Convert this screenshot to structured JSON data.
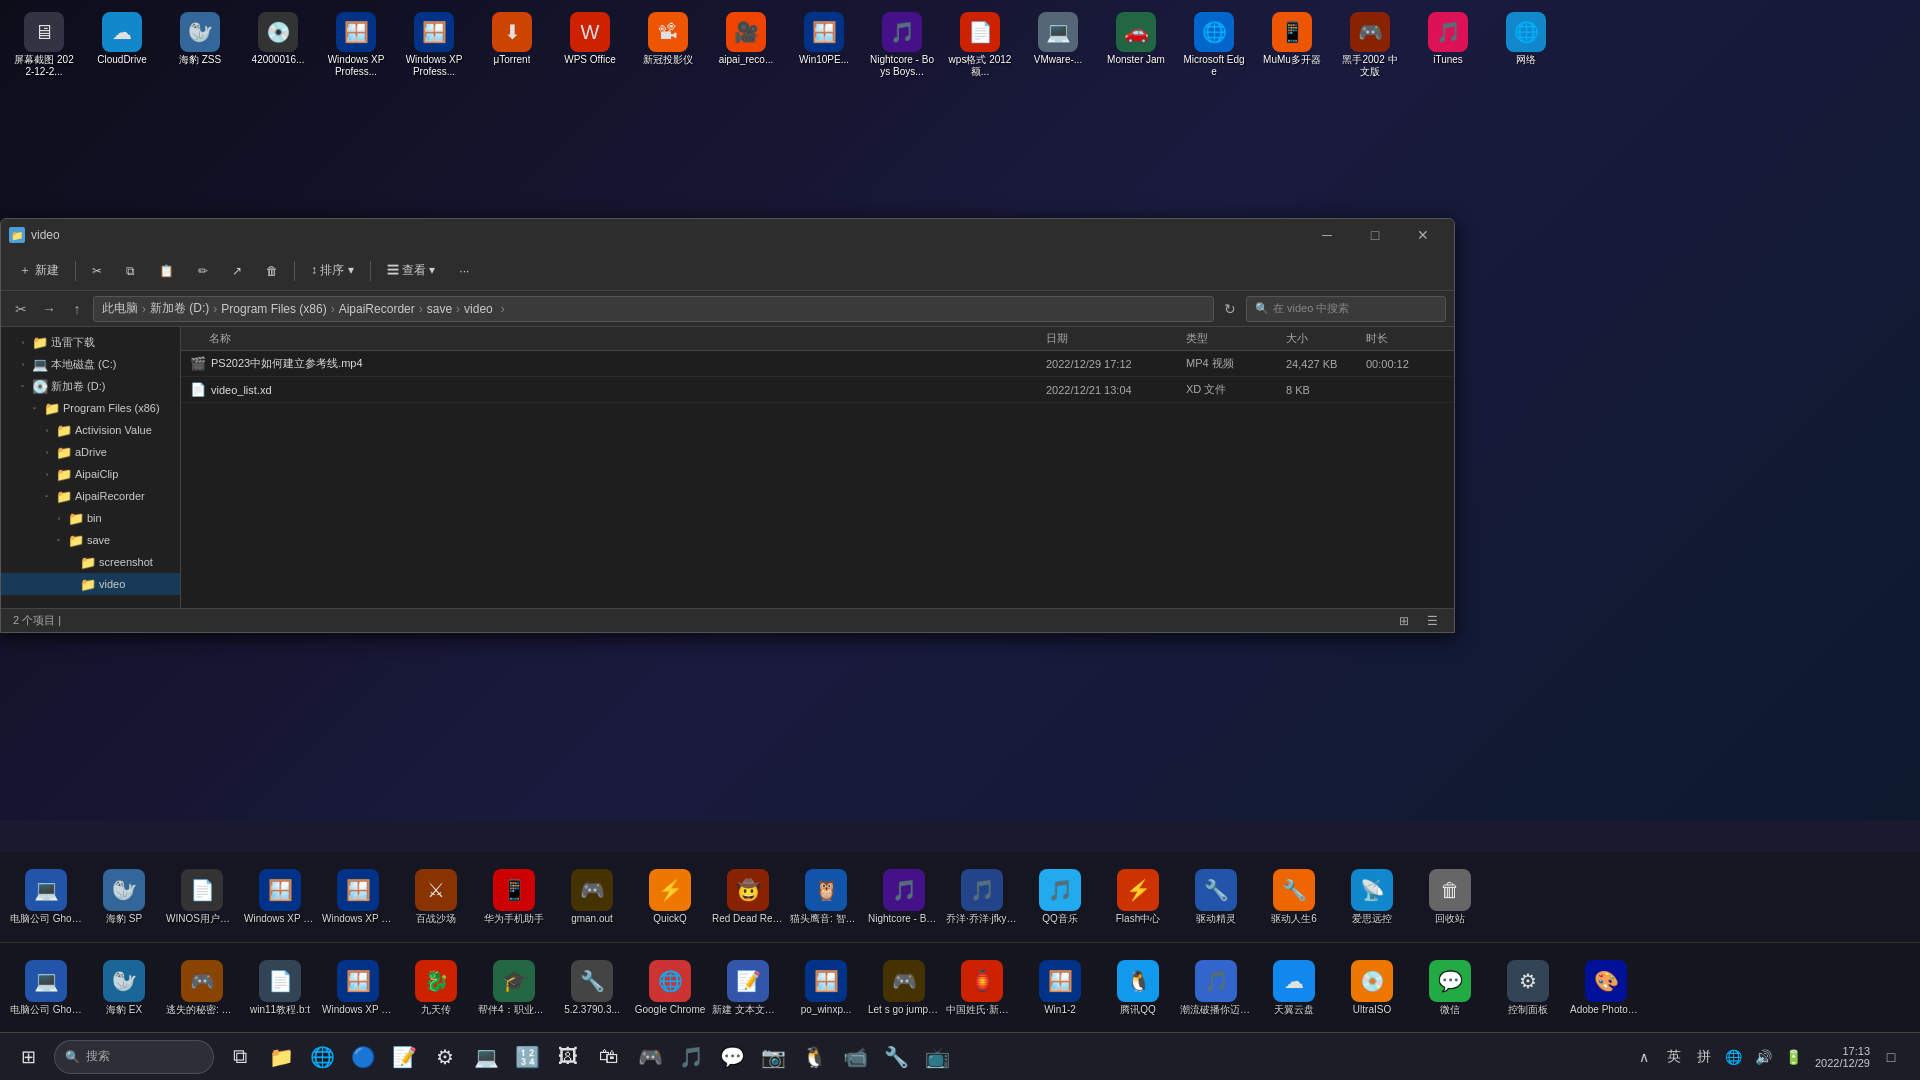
{
  "window": {
    "title": "video",
    "icon": "📁"
  },
  "titlebar": {
    "minimize": "─",
    "maximize": "□",
    "close": "✕"
  },
  "toolbar": {
    "new": "新建",
    "cut": "✂",
    "copy": "⧉",
    "paste": "📋",
    "rename": "✏",
    "share": "↗",
    "delete": "🗑",
    "sort": "↕ 排序 ▾",
    "view": "☰ 查看 ▾",
    "more": "···"
  },
  "addressbar": {
    "back": "←",
    "forward": "→",
    "up": "↑",
    "parent": "↑",
    "path": "此电脑 > 新加卷 (D:) > Program Files (x86) > AipaiRecorder > save > video",
    "breadcrumbs": [
      "此电脑",
      "新加卷 (D:)",
      "Program Files (x86)",
      "AipaiRecorder",
      "save",
      "video"
    ],
    "search_placeholder": "在 video 中搜索",
    "refresh": "↻",
    "chevron": ">"
  },
  "sidebar": {
    "items": [
      {
        "label": "迅雷下载",
        "level": 1,
        "icon": "📁",
        "expanded": false
      },
      {
        "label": "本地磁盘 (C:)",
        "level": 1,
        "icon": "💻",
        "expanded": false
      },
      {
        "label": "新加卷 (D:)",
        "level": 1,
        "icon": "💽",
        "expanded": false
      },
      {
        "label": "Program Files (x86)",
        "level": 2,
        "icon": "📁",
        "expanded": false
      },
      {
        "label": "Activision Value",
        "level": 3,
        "icon": "📁",
        "expanded": false
      },
      {
        "label": "aDrive",
        "level": 3,
        "icon": "📁",
        "expanded": false
      },
      {
        "label": "AipaiClip",
        "level": 3,
        "icon": "📁",
        "expanded": false
      },
      {
        "label": "AipaiRecorder",
        "level": 3,
        "icon": "📁",
        "expanded": true
      },
      {
        "label": "bin",
        "level": 4,
        "icon": "📁",
        "expanded": false
      },
      {
        "label": "save",
        "level": 4,
        "icon": "📁",
        "expanded": true
      },
      {
        "label": "screenshot",
        "level": 5,
        "icon": "📁",
        "expanded": false
      },
      {
        "label": "video",
        "level": 5,
        "icon": "📁",
        "expanded": false,
        "selected": true
      }
    ]
  },
  "columns": {
    "name": "名称",
    "date": "日期",
    "type": "类型",
    "size": "大小",
    "duration": "时长"
  },
  "files": [
    {
      "name": "PS2023中如何建立参考线.mp4",
      "icon": "🎬",
      "date": "2022/12/29 17:12",
      "type": "MP4 视频",
      "size": "24,427 KB",
      "duration": "00:00:12"
    },
    {
      "name": "video_list.xd",
      "icon": "📄",
      "date": "2022/12/21 13:04",
      "type": "XD 文件",
      "size": "8 KB",
      "duration": ""
    }
  ],
  "statusbar": {
    "count": "2 个项目",
    "cursor": "|"
  },
  "taskbar": {
    "start_icon": "⊞",
    "search_placeholder": "搜索",
    "time": "17:13",
    "date": "2022/12/29"
  },
  "bottom_tray1": [
    {
      "label": "电脑公司 Ghost XP ...",
      "icon": "💻",
      "color": "#2255aa"
    },
    {
      "label": "海豹 EX",
      "icon": "🦭",
      "color": "#1a6699"
    },
    {
      "label": "逃失的秘密: 梵洲风之谜",
      "icon": "🎮",
      "color": "#884400"
    },
    {
      "label": "win11教程.b:t",
      "icon": "📄",
      "color": "#334455"
    },
    {
      "label": "Windows XP Professional...",
      "icon": "🪟",
      "color": "#003388"
    },
    {
      "label": "九天传",
      "icon": "🐉",
      "color": "#cc2200"
    },
    {
      "label": "帮伴4：职业学校实习里...",
      "icon": "🎓",
      "color": "#226644"
    },
    {
      "label": "5.2.3790.3...",
      "icon": "🔧",
      "color": "#444"
    },
    {
      "label": "Google Chrome",
      "icon": "🌐",
      "color": "#cc3333"
    },
    {
      "label": "新建 文本文档档.b:t",
      "icon": "📝",
      "color": "#3355aa"
    },
    {
      "label": "po_winxp...",
      "icon": "🪟",
      "color": "#003388"
    },
    {
      "label": "Let s go jump arou...",
      "icon": "🎮",
      "color": "#443300"
    },
    {
      "label": "中国姓氏·新年快乐...",
      "icon": "🏮",
      "color": "#cc2200"
    },
    {
      "label": "Win1-2",
      "icon": "🪟",
      "color": "#003388"
    },
    {
      "label": "腾讯QQ",
      "icon": "🐧",
      "color": "#1199ee"
    },
    {
      "label": "潮流破播你迈: 迈尔豪 凰...",
      "icon": "🎵",
      "color": "#3366cc"
    },
    {
      "label": "天翼云盘",
      "icon": "☁",
      "color": "#1188ee"
    },
    {
      "label": "UltraISO",
      "icon": "💿",
      "color": "#ee7700"
    },
    {
      "label": "微信",
      "icon": "💬",
      "color": "#22aa44"
    },
    {
      "label": "控制面板",
      "icon": "⚙",
      "color": "#334455"
    },
    {
      "label": "Adobe Photosh...",
      "icon": "🎨",
      "color": "#001199"
    }
  ],
  "bottom_tray2": [
    {
      "label": "电脑公司 Ghost XP ...",
      "icon": "💻",
      "color": "#2255aa"
    },
    {
      "label": "海豹 SP",
      "icon": "🦭",
      "color": "#336699"
    },
    {
      "label": "WINOS用户名密码.b:t",
      "icon": "📄",
      "color": "#333"
    },
    {
      "label": "Windows XP Professional...",
      "icon": "🪟",
      "color": "#003388"
    },
    {
      "label": "Windows XP Professional...",
      "icon": "🪟",
      "color": "#003388"
    },
    {
      "label": "百战沙场",
      "icon": "⚔",
      "color": "#883300"
    },
    {
      "label": "华为手机助手",
      "icon": "📱",
      "color": "#cc0000"
    },
    {
      "label": "gman.out",
      "icon": "🎮",
      "color": "#443300"
    },
    {
      "label": "QuickQ",
      "icon": "⚡",
      "color": "#ee7700"
    },
    {
      "label": "Red Dead Redempt...",
      "icon": "🤠",
      "color": "#882200"
    },
    {
      "label": "猫头鹰音: 智能高清...",
      "icon": "🦉",
      "color": "#1155aa"
    },
    {
      "label": "Nightcore - Boys Boy...",
      "icon": "🎵",
      "color": "#441188"
    },
    {
      "label": "乔洋·乔洋·jfky_Stor...",
      "icon": "🎵",
      "color": "#224488"
    },
    {
      "label": "QQ音乐",
      "icon": "🎵",
      "color": "#22aaee"
    },
    {
      "label": "Flash中心",
      "icon": "⚡",
      "color": "#cc3300"
    },
    {
      "label": "驱动精灵",
      "icon": "🔧",
      "color": "#2255aa"
    },
    {
      "label": "驱动人生6",
      "icon": "🔧",
      "color": "#ee6600"
    },
    {
      "label": "爱思远控",
      "icon": "📡",
      "color": "#1188cc"
    },
    {
      "label": "回收站",
      "icon": "🗑",
      "color": "#666"
    }
  ],
  "desktop_row1": [
    {
      "label": "屏幕截图 2022-12-2...",
      "icon": "🖥",
      "color": "#334"
    },
    {
      "label": "CloudDrive",
      "icon": "☁",
      "color": "#1188cc"
    },
    {
      "label": "海豹 ZSS",
      "icon": "🦭",
      "color": "#336699"
    },
    {
      "label": "42000016...",
      "icon": "💿",
      "color": "#333"
    },
    {
      "label": "Windows XP Profess...",
      "icon": "🪟",
      "color": "#003388"
    },
    {
      "label": "Windows XP Profess...",
      "icon": "🪟",
      "color": "#003388"
    },
    {
      "label": "μTorrent",
      "icon": "⬇",
      "color": "#cc4400"
    },
    {
      "label": "WPS Office",
      "icon": "W",
      "color": "#cc2200"
    },
    {
      "label": "新冠投影仪",
      "icon": "📽",
      "color": "#ee5500"
    },
    {
      "label": "aipai_reco...",
      "icon": "🎥",
      "color": "#ee4400"
    },
    {
      "label": "Win10PE...",
      "icon": "🪟",
      "color": "#003388"
    },
    {
      "label": "Nightcore - Boys Boys...",
      "icon": "🎵",
      "color": "#441188"
    },
    {
      "label": "wps格式 2012额...",
      "icon": "📄",
      "color": "#cc2200"
    },
    {
      "label": "VMware-...",
      "icon": "💻",
      "color": "#556677"
    },
    {
      "label": "Monster Jam",
      "icon": "🚗",
      "color": "#226644"
    },
    {
      "label": "Microsoft Edge",
      "icon": "🌐",
      "color": "#0066cc"
    },
    {
      "label": "MuMu多开器",
      "icon": "📱",
      "color": "#ee5500"
    },
    {
      "label": "黑手2002 中文版",
      "icon": "🎮",
      "color": "#882200"
    },
    {
      "label": "iTunes",
      "icon": "🎵",
      "color": "#dd1155"
    },
    {
      "label": "网络",
      "icon": "🌐",
      "color": "#1188cc"
    }
  ],
  "taskbar_pinned": [
    {
      "label": "Task View",
      "icon": "⧉",
      "color": "#4488cc"
    },
    {
      "label": "File Explorer",
      "icon": "📁",
      "color": "#f0c040"
    },
    {
      "label": "Edge",
      "icon": "🌐",
      "color": "#0066cc"
    },
    {
      "label": "Chrome",
      "icon": "🔵",
      "color": "#dd3322"
    },
    {
      "label": "Notepad",
      "icon": "📝",
      "color": "#ffdd44"
    },
    {
      "label": "Settings",
      "icon": "⚙",
      "color": "#aabbcc"
    },
    {
      "label": "Terminal",
      "icon": "💻",
      "color": "#333"
    },
    {
      "label": "Calculator",
      "icon": "🔢",
      "color": "#555"
    },
    {
      "label": "Photos",
      "icon": "🖼",
      "color": "#334"
    },
    {
      "label": "Store",
      "icon": "🛍",
      "color": "#0055cc"
    },
    {
      "label": "Games",
      "icon": "🎮",
      "color": "#884400"
    },
    {
      "label": "Music",
      "icon": "🎵",
      "color": "#22aaee"
    },
    {
      "label": "WeChat",
      "icon": "💬",
      "color": "#22aa44"
    },
    {
      "label": "Camera",
      "icon": "📷",
      "color": "#334"
    },
    {
      "label": "QQ",
      "icon": "🐧",
      "color": "#1199ee"
    },
    {
      "label": "Zoom",
      "icon": "📹",
      "color": "#1166bb"
    },
    {
      "label": "Tools",
      "icon": "🔧",
      "color": "#778899"
    },
    {
      "label": "Media",
      "icon": "📺",
      "color": "#aa3300"
    }
  ]
}
